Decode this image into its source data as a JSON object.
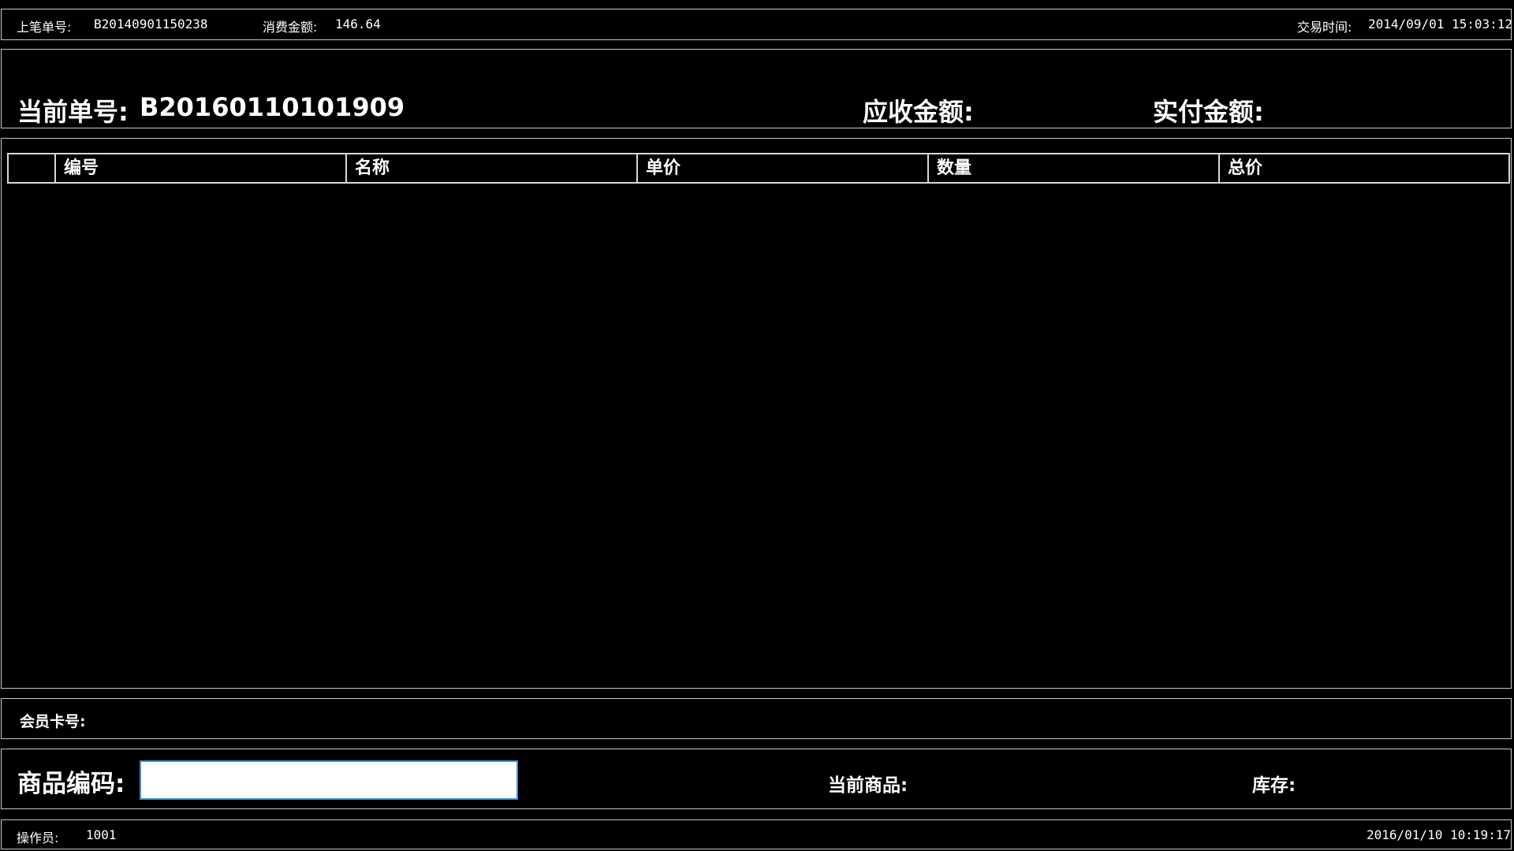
{
  "top_bar": {
    "last_order_label": "上笔单号:",
    "last_order_value": "B20140901150238",
    "amount_label": "消费金额:",
    "amount_value": "146.64",
    "time_label": "交易时间:",
    "time_value": "2014/09/01 15:03:12"
  },
  "header": {
    "current_order_label": "当前单号:",
    "current_order_value": "B20160110101909",
    "receivable_label": "应收金额:",
    "paid_label": "实付金额:"
  },
  "table": {
    "columns": [
      "编号",
      "名称",
      "单价",
      "数量",
      "总价"
    ],
    "rows": []
  },
  "member": {
    "label": "会员卡号:"
  },
  "product": {
    "code_label": "商品编码:",
    "code_value": "",
    "current_label": "当前商品:",
    "stock_label": "库存:"
  },
  "status_bar": {
    "operator_label": "操作员:",
    "operator_value": "1001",
    "datetime": "2016/01/10 10:19:17"
  }
}
